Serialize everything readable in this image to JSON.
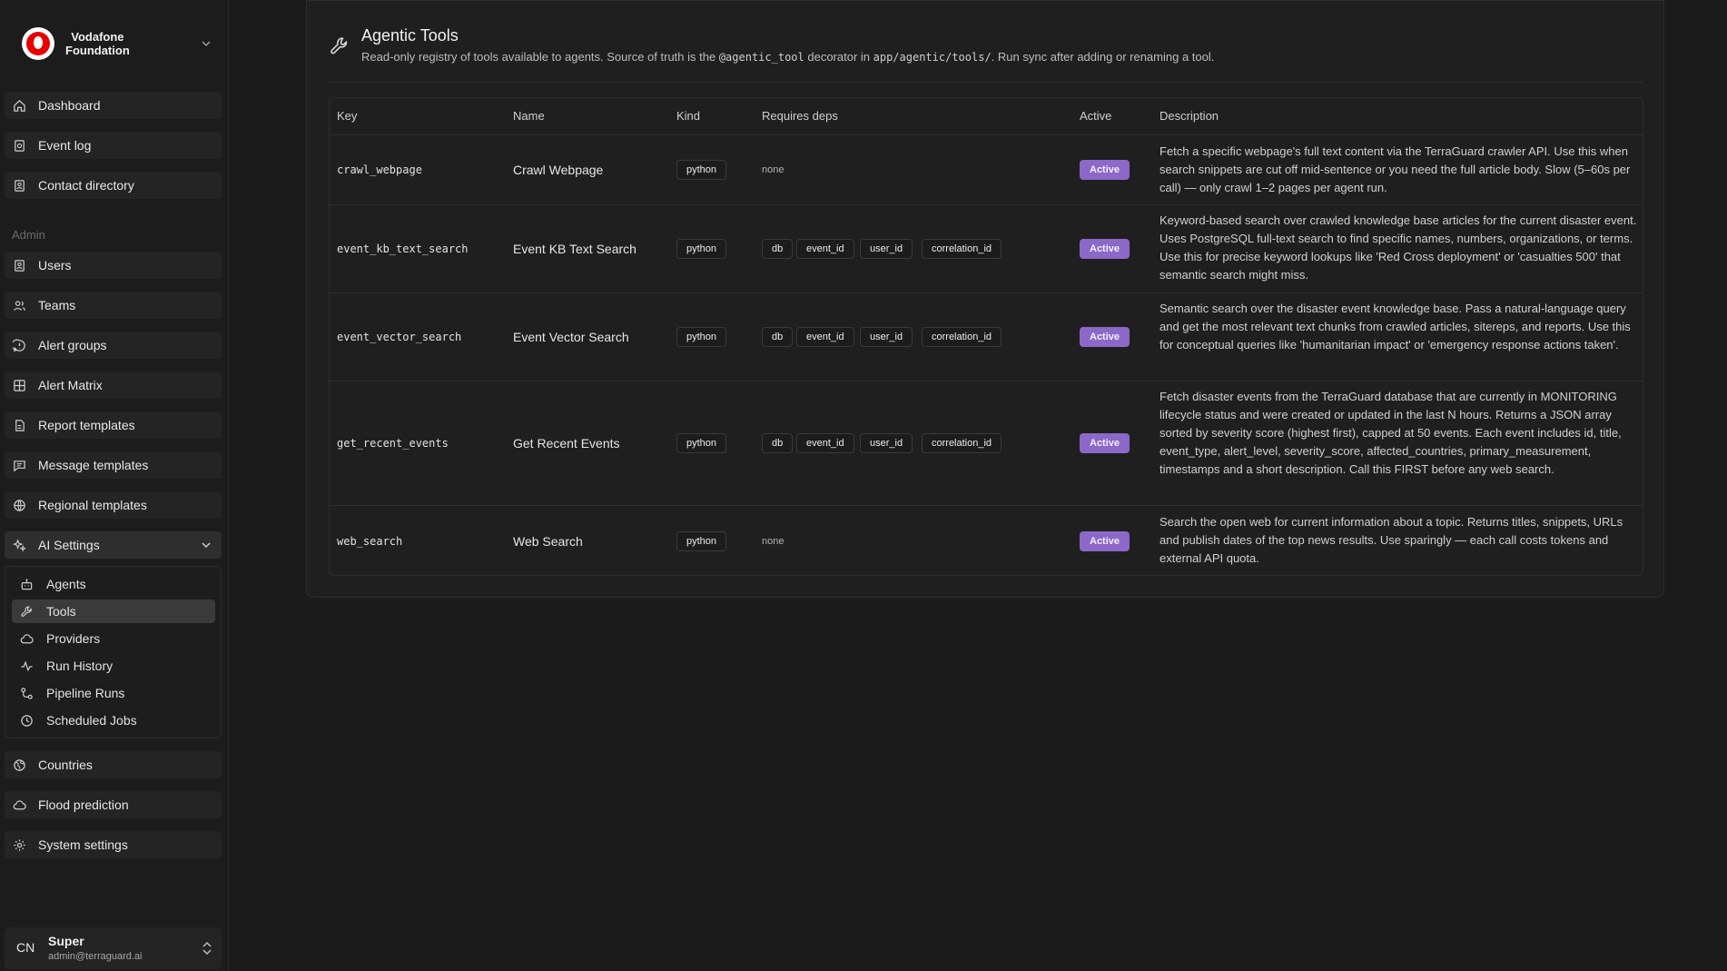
{
  "brand": {
    "line1": "Vodafone",
    "line2": "Foundation"
  },
  "nav": {
    "top": [
      "Dashboard",
      "Event log",
      "Contact directory"
    ],
    "admin_label": "Admin",
    "admin": [
      "Users",
      "Teams",
      "Alert groups",
      "Alert Matrix",
      "Report templates",
      "Message templates",
      "Regional templates"
    ],
    "ai_settings": "AI Settings",
    "ai_sub": [
      "Agents",
      "Tools",
      "Providers",
      "Run History",
      "Pipeline Runs",
      "Scheduled Jobs"
    ],
    "bottom": [
      "Countries",
      "Flood prediction",
      "System settings"
    ]
  },
  "user": {
    "initials": "CN",
    "name": "Super",
    "email": "admin@terraguard.ai"
  },
  "page": {
    "title": "Agentic Tools",
    "sub_prefix": "Read-only registry of tools available to agents. Source of truth is the ",
    "sub_code1": "@agentic_tool",
    "sub_mid": " decorator in ",
    "sub_code2": "app/agentic/tools/",
    "sub_suffix": ". Run sync after adding or renaming a tool."
  },
  "table": {
    "headers": [
      "Key",
      "Name",
      "Kind",
      "Requires deps",
      "Active",
      "Description"
    ],
    "rows": [
      {
        "key": "crawl_webpage",
        "name": "Crawl Webpage",
        "kind": "python",
        "deps": [],
        "none": "none",
        "active": "Active",
        "description": "Fetch a specific webpage's full text content via the TerraGuard crawler API. Use this when search snippets are cut off mid-sentence or you need the full article body. Slow (5–60s per call) — only crawl 1–2 pages per agent run."
      },
      {
        "key": "event_kb_text_search",
        "name": "Event KB Text Search",
        "kind": "python",
        "deps": [
          "db",
          "event_id",
          "user_id",
          "correlation_id"
        ],
        "active": "Active",
        "description": "Keyword-based search over crawled knowledge base articles for the current disaster event. Uses PostgreSQL full-text search to find specific names, numbers, organizations, or terms. Use this for precise keyword lookups like 'Red Cross deployment' or 'casualties 500' that semantic search might miss."
      },
      {
        "key": "event_vector_search",
        "name": "Event Vector Search",
        "kind": "python",
        "deps": [
          "db",
          "event_id",
          "user_id",
          "correlation_id"
        ],
        "active": "Active",
        "description": "Semantic search over the disaster event knowledge base. Pass a natural-language query and get the most relevant text chunks from crawled articles, sitereps, and reports. Use this for conceptual queries like 'humanitarian impact' or 'emergency response actions taken'."
      },
      {
        "key": "get_recent_events",
        "name": "Get Recent Events",
        "kind": "python",
        "deps": [
          "db",
          "event_id",
          "user_id",
          "correlation_id"
        ],
        "active": "Active",
        "description": "Fetch disaster events from the TerraGuard database that are currently in MONITORING lifecycle status and were created or updated in the last N hours. Returns a JSON array sorted by severity score (highest first), capped at 50 events. Each event includes id, title, event_type, alert_level, severity_score, affected_countries, primary_measurement, timestamps and a short description. Call this FIRST before any web search."
      },
      {
        "key": "web_search",
        "name": "Web Search",
        "kind": "python",
        "deps": [],
        "none": "none",
        "active": "Active",
        "description": "Search the open web for current information about a topic. Returns titles, snippets, URLs and publish dates of the top news results. Use sparingly — each call costs tokens and external API quota."
      }
    ]
  }
}
